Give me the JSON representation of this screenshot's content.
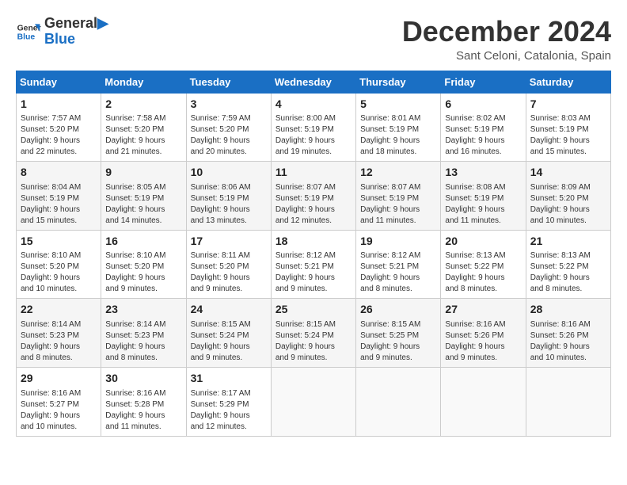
{
  "logo": {
    "line1": "General",
    "line2": "Blue"
  },
  "title": "December 2024",
  "subtitle": "Sant Celoni, Catalonia, Spain",
  "weekdays": [
    "Sunday",
    "Monday",
    "Tuesday",
    "Wednesday",
    "Thursday",
    "Friday",
    "Saturday"
  ],
  "weeks": [
    [
      {
        "day": "1",
        "info": "Sunrise: 7:57 AM\nSunset: 5:20 PM\nDaylight: 9 hours\nand 22 minutes."
      },
      {
        "day": "2",
        "info": "Sunrise: 7:58 AM\nSunset: 5:20 PM\nDaylight: 9 hours\nand 21 minutes."
      },
      {
        "day": "3",
        "info": "Sunrise: 7:59 AM\nSunset: 5:20 PM\nDaylight: 9 hours\nand 20 minutes."
      },
      {
        "day": "4",
        "info": "Sunrise: 8:00 AM\nSunset: 5:19 PM\nDaylight: 9 hours\nand 19 minutes."
      },
      {
        "day": "5",
        "info": "Sunrise: 8:01 AM\nSunset: 5:19 PM\nDaylight: 9 hours\nand 18 minutes."
      },
      {
        "day": "6",
        "info": "Sunrise: 8:02 AM\nSunset: 5:19 PM\nDaylight: 9 hours\nand 16 minutes."
      },
      {
        "day": "7",
        "info": "Sunrise: 8:03 AM\nSunset: 5:19 PM\nDaylight: 9 hours\nand 15 minutes."
      }
    ],
    [
      {
        "day": "8",
        "info": "Sunrise: 8:04 AM\nSunset: 5:19 PM\nDaylight: 9 hours\nand 15 minutes."
      },
      {
        "day": "9",
        "info": "Sunrise: 8:05 AM\nSunset: 5:19 PM\nDaylight: 9 hours\nand 14 minutes."
      },
      {
        "day": "10",
        "info": "Sunrise: 8:06 AM\nSunset: 5:19 PM\nDaylight: 9 hours\nand 13 minutes."
      },
      {
        "day": "11",
        "info": "Sunrise: 8:07 AM\nSunset: 5:19 PM\nDaylight: 9 hours\nand 12 minutes."
      },
      {
        "day": "12",
        "info": "Sunrise: 8:07 AM\nSunset: 5:19 PM\nDaylight: 9 hours\nand 11 minutes."
      },
      {
        "day": "13",
        "info": "Sunrise: 8:08 AM\nSunset: 5:19 PM\nDaylight: 9 hours\nand 11 minutes."
      },
      {
        "day": "14",
        "info": "Sunrise: 8:09 AM\nSunset: 5:20 PM\nDaylight: 9 hours\nand 10 minutes."
      }
    ],
    [
      {
        "day": "15",
        "info": "Sunrise: 8:10 AM\nSunset: 5:20 PM\nDaylight: 9 hours\nand 10 minutes."
      },
      {
        "day": "16",
        "info": "Sunrise: 8:10 AM\nSunset: 5:20 PM\nDaylight: 9 hours\nand 9 minutes."
      },
      {
        "day": "17",
        "info": "Sunrise: 8:11 AM\nSunset: 5:20 PM\nDaylight: 9 hours\nand 9 minutes."
      },
      {
        "day": "18",
        "info": "Sunrise: 8:12 AM\nSunset: 5:21 PM\nDaylight: 9 hours\nand 9 minutes."
      },
      {
        "day": "19",
        "info": "Sunrise: 8:12 AM\nSunset: 5:21 PM\nDaylight: 9 hours\nand 8 minutes."
      },
      {
        "day": "20",
        "info": "Sunrise: 8:13 AM\nSunset: 5:22 PM\nDaylight: 9 hours\nand 8 minutes."
      },
      {
        "day": "21",
        "info": "Sunrise: 8:13 AM\nSunset: 5:22 PM\nDaylight: 9 hours\nand 8 minutes."
      }
    ],
    [
      {
        "day": "22",
        "info": "Sunrise: 8:14 AM\nSunset: 5:23 PM\nDaylight: 9 hours\nand 8 minutes."
      },
      {
        "day": "23",
        "info": "Sunrise: 8:14 AM\nSunset: 5:23 PM\nDaylight: 9 hours\nand 8 minutes."
      },
      {
        "day": "24",
        "info": "Sunrise: 8:15 AM\nSunset: 5:24 PM\nDaylight: 9 hours\nand 9 minutes."
      },
      {
        "day": "25",
        "info": "Sunrise: 8:15 AM\nSunset: 5:24 PM\nDaylight: 9 hours\nand 9 minutes."
      },
      {
        "day": "26",
        "info": "Sunrise: 8:15 AM\nSunset: 5:25 PM\nDaylight: 9 hours\nand 9 minutes."
      },
      {
        "day": "27",
        "info": "Sunrise: 8:16 AM\nSunset: 5:26 PM\nDaylight: 9 hours\nand 9 minutes."
      },
      {
        "day": "28",
        "info": "Sunrise: 8:16 AM\nSunset: 5:26 PM\nDaylight: 9 hours\nand 10 minutes."
      }
    ],
    [
      {
        "day": "29",
        "info": "Sunrise: 8:16 AM\nSunset: 5:27 PM\nDaylight: 9 hours\nand 10 minutes."
      },
      {
        "day": "30",
        "info": "Sunrise: 8:16 AM\nSunset: 5:28 PM\nDaylight: 9 hours\nand 11 minutes."
      },
      {
        "day": "31",
        "info": "Sunrise: 8:17 AM\nSunset: 5:29 PM\nDaylight: 9 hours\nand 12 minutes."
      },
      null,
      null,
      null,
      null
    ]
  ]
}
